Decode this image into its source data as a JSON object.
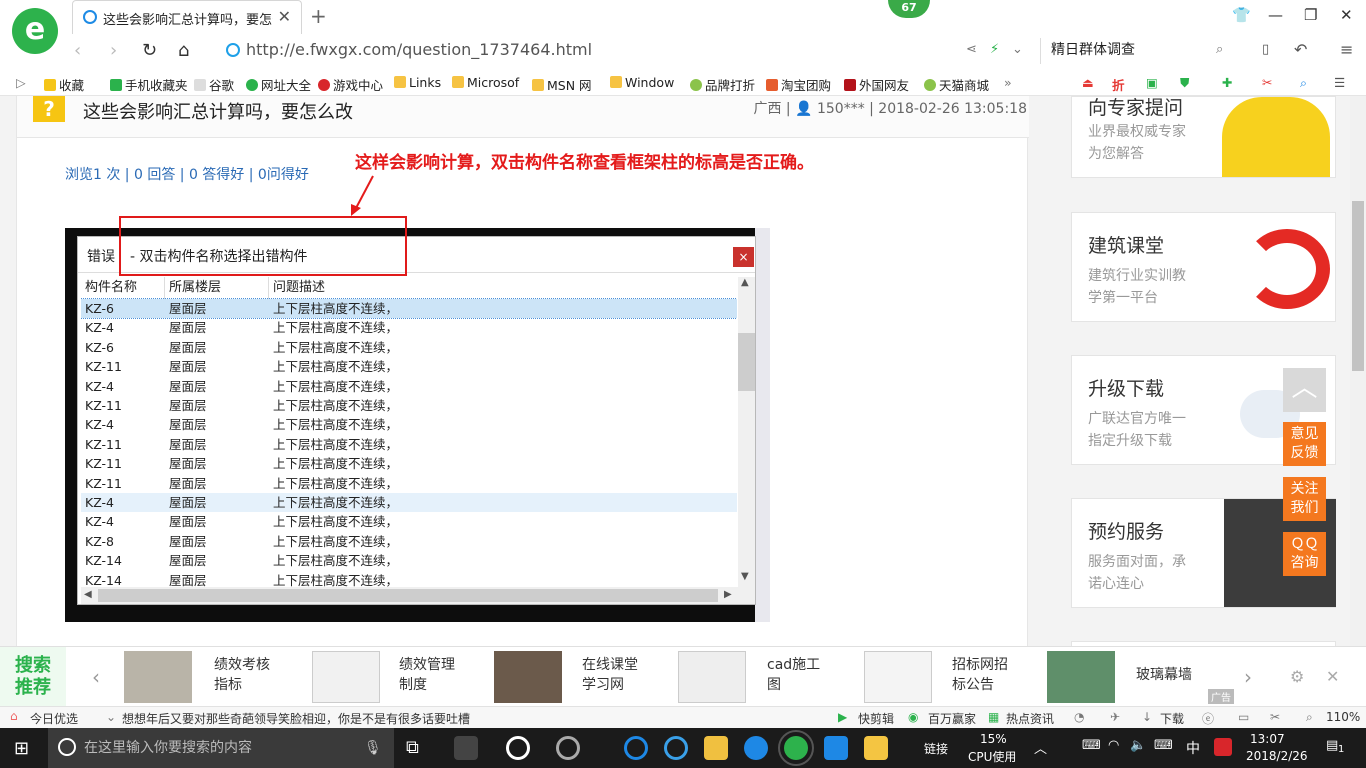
{
  "browser": {
    "tab_title": "这些会影响汇总计算吗，要怎么改",
    "badge": "67",
    "url": "http://e.fwxgx.com/question_1737464.html",
    "search_text": "精日群体调查"
  },
  "favorites": [
    "收藏",
    "手机收藏夹",
    "谷歌",
    "网址大全",
    "游戏中心",
    "Links",
    "Microsof",
    "MSN 网",
    "Window",
    "品牌打折",
    "淘宝团购",
    "外国网友",
    "天猫商城"
  ],
  "question": {
    "title": "这些会影响汇总计算吗，要怎么改",
    "meta": "广西 | 👤 150*** | 2018-02-26 13:05:18",
    "stats": "浏览1 次 | 0 回答 | 0 答得好 | 0问得好",
    "annotation": "这样会影响计算，双击构件名称查看框架柱的标高是否正确。"
  },
  "dialog": {
    "title": "错误",
    "subtitle": "- 双击构件名称选择出错构件",
    "close": "×",
    "columns": [
      "构件名称",
      "所属楼层",
      "问题描述"
    ],
    "rows": [
      [
        "KZ-6",
        "屋面层",
        "上下层柱高度不连续，"
      ],
      [
        "KZ-4",
        "屋面层",
        "上下层柱高度不连续，"
      ],
      [
        "KZ-6",
        "屋面层",
        "上下层柱高度不连续，"
      ],
      [
        "KZ-11",
        "屋面层",
        "上下层柱高度不连续，"
      ],
      [
        "KZ-4",
        "屋面层",
        "上下层柱高度不连续，"
      ],
      [
        "KZ-11",
        "屋面层",
        "上下层柱高度不连续，"
      ],
      [
        "KZ-4",
        "屋面层",
        "上下层柱高度不连续，"
      ],
      [
        "KZ-11",
        "屋面层",
        "上下层柱高度不连续，"
      ],
      [
        "KZ-11",
        "屋面层",
        "上下层柱高度不连续，"
      ],
      [
        "KZ-11",
        "屋面层",
        "上下层柱高度不连续，"
      ],
      [
        "KZ-4",
        "屋面层",
        "上下层柱高度不连续，"
      ],
      [
        "KZ-4",
        "屋面层",
        "上下层柱高度不连续，"
      ],
      [
        "KZ-8",
        "屋面层",
        "上下层柱高度不连续，"
      ],
      [
        "KZ-14",
        "屋面层",
        "上下层柱高度不连续，"
      ],
      [
        "KZ-14",
        "屋面层",
        "上下层柱高度不连续，"
      ]
    ]
  },
  "sidebar": {
    "cards": [
      {
        "title": "向专家提问",
        "desc": "业界最权威专家\n为您解答"
      },
      {
        "title": "建筑课堂",
        "desc": "建筑行业实训教\n学第一平台"
      },
      {
        "title": "升级下载",
        "desc": "广联达官方唯一\n指定升级下载"
      },
      {
        "title": "预约服务",
        "desc": "服务面对面，承\n诺心连心"
      }
    ],
    "float_buttons": [
      "意见\n反馈",
      "关注\n我们",
      "ＱＱ\n咨询"
    ]
  },
  "recommend": {
    "label": "搜索\n推荐",
    "items": [
      "绩效考核\n指标",
      "绩效管理\n制度",
      "在线课堂\n学习网",
      "cad施工\n图",
      "招标网招\n标公告",
      "玻璃幕墙"
    ],
    "ad": "广告"
  },
  "status": {
    "today": "今日优选",
    "headline": "想想年后又要对那些奇葩领导笑脸相迎，你是不是有很多话要吐槽",
    "tools": [
      "快剪辑",
      "百万赢家",
      "热点资讯",
      "下载"
    ],
    "zoom": "110%"
  },
  "taskbar": {
    "search_placeholder": "在这里输入你要搜索的内容",
    "cpu_pct": "15%",
    "cpu_label": "CPU使用",
    "link": "链接",
    "ime": "中",
    "time": "13:07",
    "date": "2018/2/26",
    "notify": "1"
  }
}
